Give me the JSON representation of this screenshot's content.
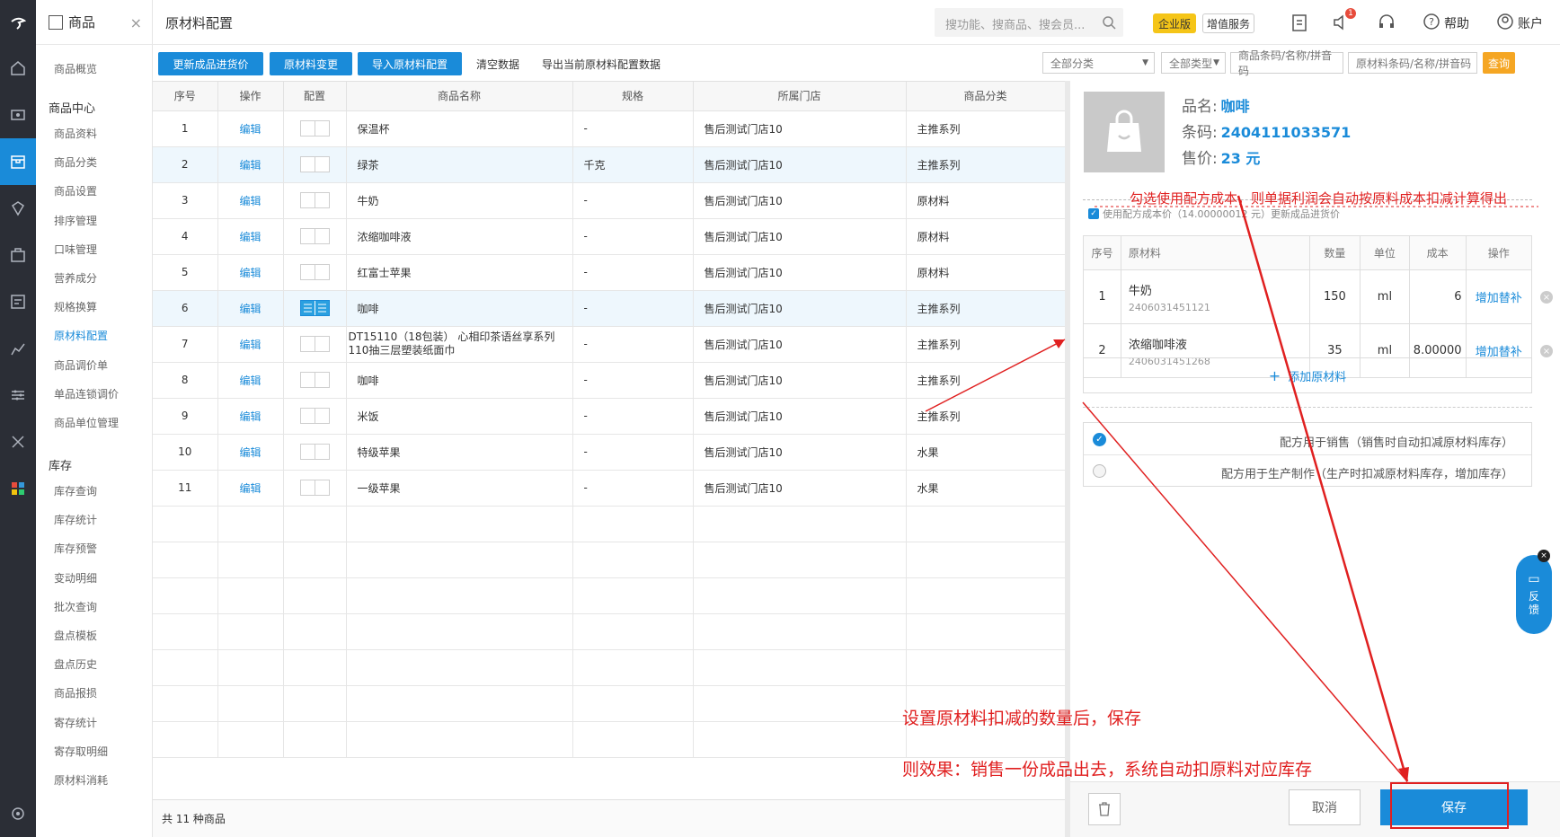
{
  "menu": {
    "title": "商品",
    "items_top": [
      "商品概览"
    ],
    "group1": "商品中心",
    "items_g1": [
      "商品资料",
      "商品分类",
      "商品设置",
      "排序管理",
      "口味管理",
      "营养成分",
      "规格换算",
      "原材料配置",
      "商品调价单",
      "单品连锁调价",
      "商品单位管理"
    ],
    "group2": "库存",
    "items_g2": [
      "库存查询",
      "库存统计",
      "库存预警",
      "变动明细",
      "批次查询",
      "盘点模板",
      "盘点历史",
      "商品报损",
      "寄存统计",
      "寄存取明细",
      "原材料消耗"
    ]
  },
  "top": {
    "title": "原材料配置",
    "search_placeholder": "搜功能、搜商品、搜会员...",
    "badge_enterprise": "企业版",
    "badge_addon": "增值服务",
    "notif_count": "1",
    "help": "帮助",
    "account": "账户"
  },
  "toolbar": {
    "btn_update": "更新成品进货价",
    "btn_change": "原材料变更",
    "btn_import": "导入原材料配置",
    "btn_clear": "清空数据",
    "btn_export": "导出当前原材料配置数据",
    "filter_category": "全部分类",
    "filter_type": "全部类型",
    "input_product_placeholder": "商品条码/名称/拼音码",
    "input_material_placeholder": "原材料条码/名称/拼音码",
    "btn_query": "查询"
  },
  "grid": {
    "headers": [
      "序号",
      "操作",
      "配置",
      "商品名称",
      "规格",
      "所属门店",
      "商品分类"
    ],
    "edit_label": "编辑",
    "rows": [
      {
        "no": "1",
        "name": "保温杯",
        "spec": "-",
        "store": "售后测试门店10",
        "cat": "主推系列"
      },
      {
        "no": "2",
        "name": "绿茶",
        "spec": "千克",
        "store": "售后测试门店10",
        "cat": "主推系列"
      },
      {
        "no": "3",
        "name": "牛奶",
        "spec": "-",
        "store": "售后测试门店10",
        "cat": "原材料"
      },
      {
        "no": "4",
        "name": "浓缩咖啡液",
        "spec": "-",
        "store": "售后测试门店10",
        "cat": "原材料"
      },
      {
        "no": "5",
        "name": "红富士苹果",
        "spec": "-",
        "store": "售后测试门店10",
        "cat": "原材料"
      },
      {
        "no": "6",
        "name": "咖啡",
        "spec": "-",
        "store": "售后测试门店10",
        "cat": "主推系列"
      },
      {
        "no": "7",
        "name": "DT15110（18包装） 心相印茶语丝享系列110抽三层塑装纸面巾",
        "spec": "-",
        "store": "售后测试门店10",
        "cat": "主推系列"
      },
      {
        "no": "8",
        "name": "咖啡",
        "spec": "-",
        "store": "售后测试门店10",
        "cat": "主推系列"
      },
      {
        "no": "9",
        "name": "米饭",
        "spec": "-",
        "store": "售后测试门店10",
        "cat": "主推系列"
      },
      {
        "no": "10",
        "name": "特级苹果",
        "spec": "-",
        "store": "售后测试门店10",
        "cat": "水果"
      },
      {
        "no": "11",
        "name": "一级苹果",
        "spec": "-",
        "store": "售后测试门店10",
        "cat": "水果"
      }
    ],
    "footer": "共 11 种商品"
  },
  "panel": {
    "name_label": "品名:",
    "name_value": "咖啡",
    "barcode_label": "条码:",
    "barcode_value": "2404111033571",
    "price_label": "售价:",
    "price_value": "23 元",
    "use_formula_text": "使用配方成本价（14.00000012 元）更新成品进货价",
    "headers": [
      "序号",
      "原材料",
      "数量",
      "单位",
      "成本",
      "操作"
    ],
    "materials": [
      {
        "no": "1",
        "name": "牛奶",
        "code": "2406031451121",
        "qty": "150",
        "unit": "ml",
        "cost": "6",
        "op": "增加替补"
      },
      {
        "no": "2",
        "name": "浓缩咖啡液",
        "code": "2406031451268",
        "qty": "35",
        "unit": "ml",
        "cost": "8.00000",
        "op": "增加替补"
      }
    ],
    "add_material": "添加原材料",
    "option_sale": "配方用于销售（销售时自动扣减原材料库存）",
    "option_produce": "配方用于生产制作（生产时扣减原材料库存，增加库存）",
    "cancel": "取消",
    "save": "保存",
    "feedback": "反馈"
  },
  "annotations": {
    "note1": "勾选使用配方成本，则单据利润会自动按原料成本扣减计算得出",
    "note2": "设置原材料扣减的数量后，保存",
    "note3": "则效果：销售一份成品出去，系统自动扣原料对应库存"
  },
  "colors": {
    "accent": "#1a8bd9",
    "annotation": "#e02020",
    "query": "#f5a623",
    "badge": "#f5c518"
  }
}
